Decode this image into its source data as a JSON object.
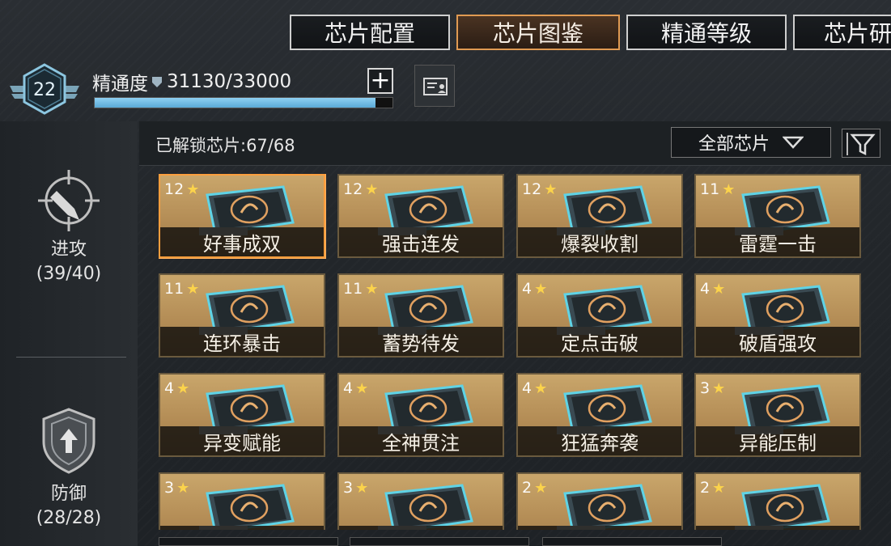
{
  "tabs": [
    {
      "label": "芯片配置",
      "active": false
    },
    {
      "label": "芯片图鉴",
      "active": true
    },
    {
      "label": "精通等级",
      "active": false
    },
    {
      "label": "芯片研",
      "active": false
    }
  ],
  "mastery": {
    "level": "22",
    "label": "精通度",
    "value": "31130/33000",
    "progress": 0.943,
    "plus_label": "+"
  },
  "sidebar": {
    "categories": [
      {
        "name": "进攻",
        "count": "(39/40)",
        "icon": "crosshair-missile-icon"
      },
      {
        "name": "防御",
        "count": "(28/28)",
        "icon": "shield-arrow-icon"
      }
    ]
  },
  "header": {
    "unlocked": "已解锁芯片:67/68",
    "filter_label": "全部芯片",
    "filter_icon": "funnel-icon"
  },
  "colors": {
    "accent_orange": "#e09a52",
    "card_gold": "#c9a66b",
    "star_yellow": "#ffd64a",
    "progress_blue": "#7cc3ea"
  },
  "chips": [
    {
      "name": "好事成双",
      "level": "12",
      "selected": true
    },
    {
      "name": "强击连发",
      "level": "12",
      "selected": false
    },
    {
      "name": "爆裂收割",
      "level": "12",
      "selected": false
    },
    {
      "name": "雷霆一击",
      "level": "11",
      "selected": false
    },
    {
      "name": "连环暴击",
      "level": "11",
      "selected": false
    },
    {
      "name": "蓄势待发",
      "level": "11",
      "selected": false
    },
    {
      "name": "定点击破",
      "level": "4",
      "selected": false
    },
    {
      "name": "破盾强攻",
      "level": "4",
      "selected": false
    },
    {
      "name": "异变赋能",
      "level": "4",
      "selected": false
    },
    {
      "name": "全神贯注",
      "level": "4",
      "selected": false
    },
    {
      "name": "狂猛奔袭",
      "level": "4",
      "selected": false
    },
    {
      "name": "异能压制",
      "level": "3",
      "selected": false
    },
    {
      "name": "",
      "level": "3",
      "selected": false
    },
    {
      "name": "",
      "level": "3",
      "selected": false
    },
    {
      "name": "",
      "level": "2",
      "selected": false
    },
    {
      "name": "",
      "level": "2",
      "selected": false
    }
  ]
}
